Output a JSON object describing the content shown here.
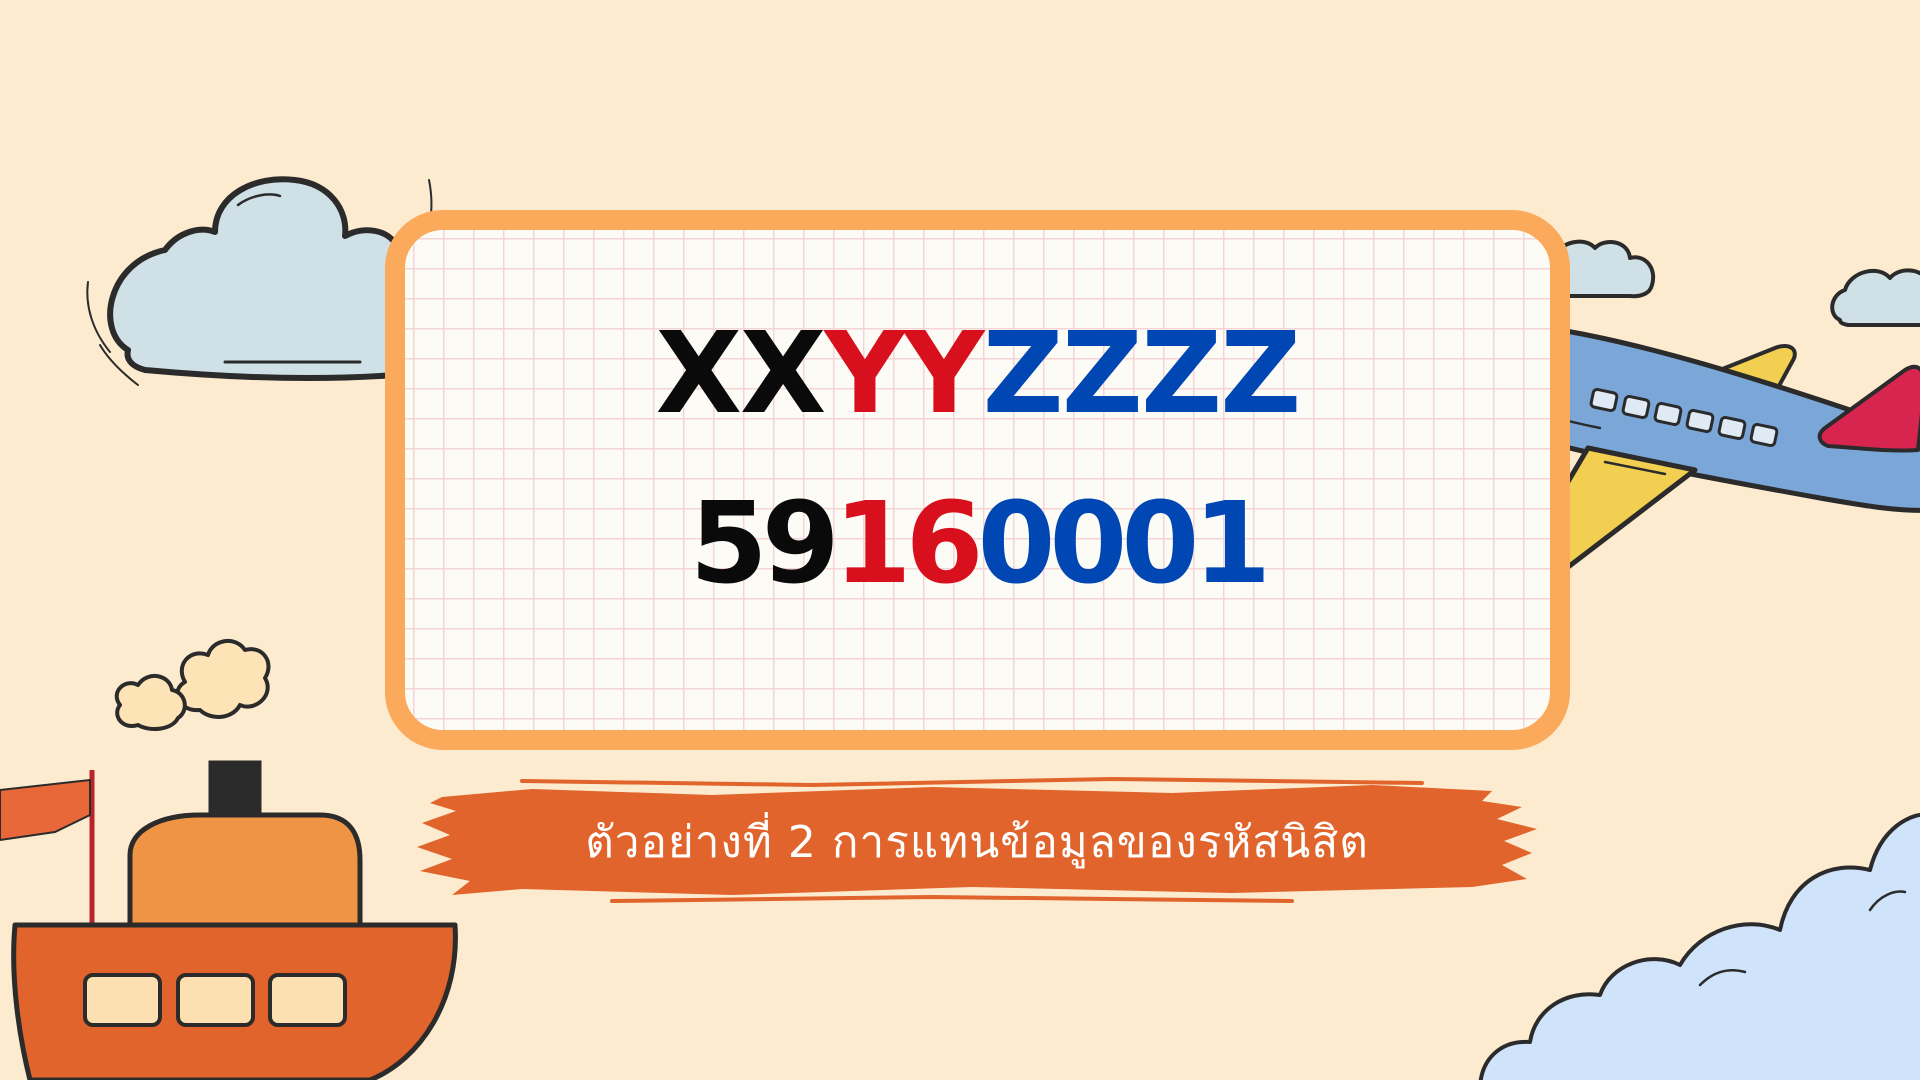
{
  "slide": {
    "code_format": {
      "part_1": "XX",
      "part_2": "YY",
      "part_3": "ZZZZ"
    },
    "code_example": {
      "part_1": "59",
      "part_2": "16",
      "part_3": "0001"
    },
    "caption": "ตัวอย่างที่ 2 การแทนข้อมูลของรหัสนิสิต"
  },
  "colors": {
    "background": "#fdebd0",
    "card_border": "#fba95a",
    "segment_1": "#0a0a0a",
    "segment_2": "#d80f1c",
    "segment_3": "#0047b3",
    "banner": "#e0642b"
  },
  "decorations": [
    "cloud-icon",
    "airplane-icon",
    "steamboat-icon",
    "flag-icon"
  ]
}
